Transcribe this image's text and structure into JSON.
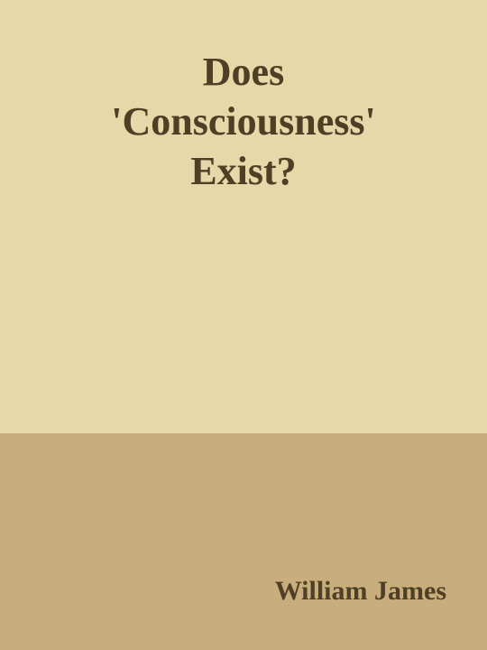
{
  "cover": {
    "title_lines": [
      "Does",
      "'Consciousness'",
      "Exist?"
    ],
    "author": "William James",
    "colors": {
      "background": "#e6d8a9",
      "bottom_band": "#c8ae7c",
      "text": "#4f3f24"
    }
  }
}
